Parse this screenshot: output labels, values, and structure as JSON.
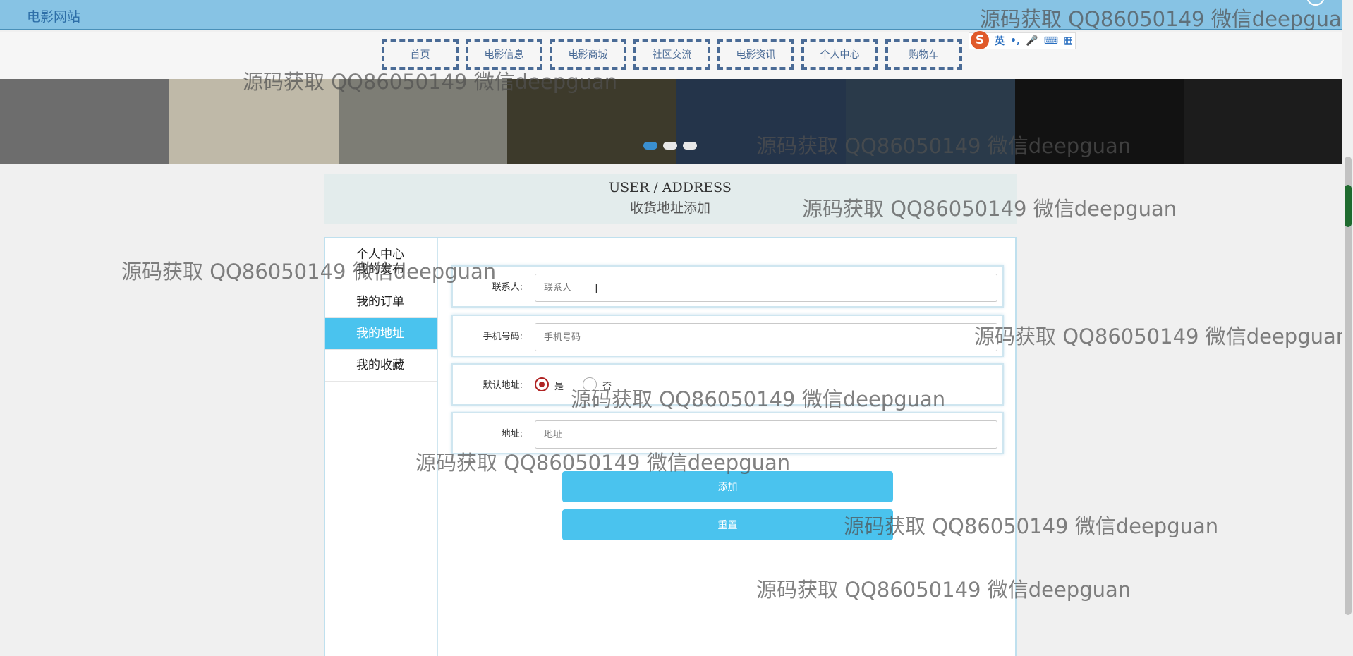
{
  "header": {
    "site_title": "电影网站"
  },
  "nav": {
    "items": [
      "首页",
      "电影信息",
      "电影商城",
      "社区交流",
      "电影资讯",
      "个人中心",
      "购物车"
    ]
  },
  "ime": {
    "logo": "S",
    "lang": "英",
    "symbols": [
      "•,",
      "🎤",
      "⌨",
      "▦"
    ]
  },
  "banner": {
    "posters": [
      "#6d6d6d",
      "#bfb9a8",
      "#7d7d75",
      "#3d3a2b",
      "#24344a",
      "#2a3a4a",
      "#121212",
      "#1c1c1c"
    ],
    "dots": [
      true,
      false,
      false
    ]
  },
  "page_title": {
    "en": "USER / ADDRESS",
    "cn": "收货地址添加"
  },
  "sidebar": {
    "items": [
      "个人中心",
      "我的发布",
      "我的订单",
      "我的地址",
      "我的收藏"
    ],
    "active": "我的地址"
  },
  "form": {
    "contact": {
      "label": "联系人:",
      "placeholder": "联系人"
    },
    "phone": {
      "label": "手机号码:",
      "placeholder": "手机号码"
    },
    "default": {
      "label": "默认地址:",
      "yes": "是",
      "no": "否",
      "selected": "是"
    },
    "address": {
      "label": "地址:",
      "placeholder": "地址"
    },
    "submit_label": "添加",
    "reset_label": "重置"
  },
  "watermark": "源码获取 QQ86050149 微信deepguan",
  "colors": {
    "accent": "#4ac3ee",
    "header": "#87c3e4",
    "nav_border": "#4a6b96"
  }
}
